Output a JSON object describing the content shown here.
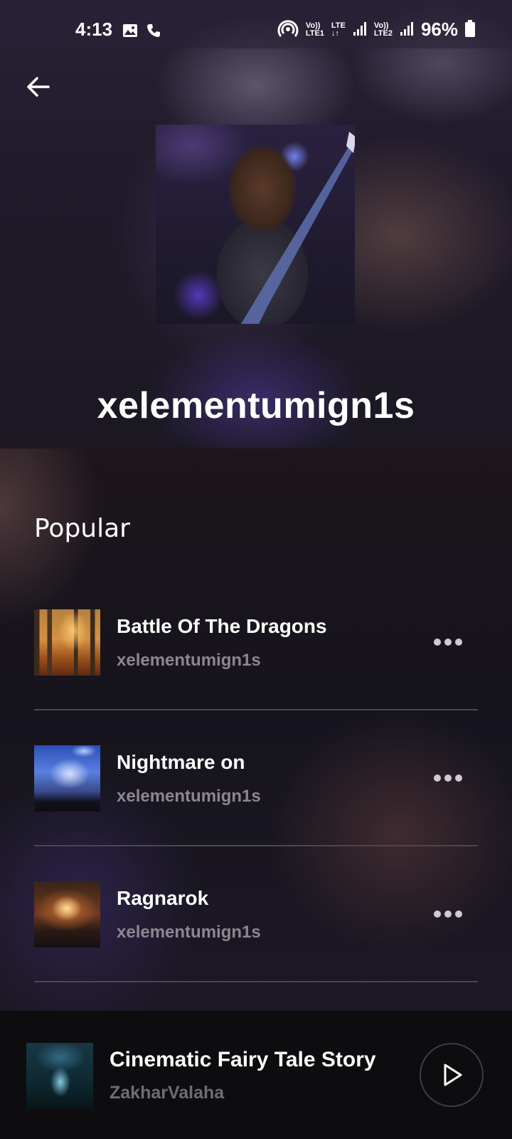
{
  "status_bar": {
    "time": "4:13",
    "sim1_label": "LTE1",
    "sim2_label": "LTE2",
    "network_type": "LTE",
    "battery": "96%"
  },
  "header": {
    "artist_name": "xelementumign1s"
  },
  "popular": {
    "title": "Popular",
    "tracks": [
      {
        "title": "Battle Of The Dragons",
        "artist": "xelementumign1s"
      },
      {
        "title": "Nightmare on",
        "artist": "xelementumign1s"
      },
      {
        "title": "Ragnarok",
        "artist": "xelementumign1s"
      }
    ]
  },
  "now_playing": {
    "title": "Cinematic Fairy Tale Story",
    "artist": "ZakharValaha"
  },
  "icons": {
    "back": "arrow-left-icon",
    "more": "more-horizontal-icon",
    "play": "play-icon"
  }
}
